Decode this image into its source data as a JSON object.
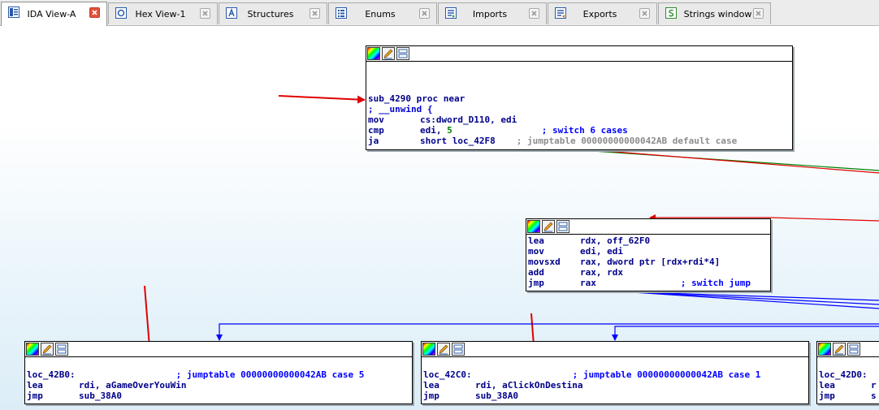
{
  "tabs": [
    {
      "label": "IDA View-A",
      "icon": "ida-view-icon",
      "active": true
    },
    {
      "label": "Hex View-1",
      "icon": "hex-view-icon",
      "active": false
    },
    {
      "label": "Structures",
      "icon": "structures-icon",
      "active": false
    },
    {
      "label": "Enums",
      "icon": "enums-icon",
      "active": false
    },
    {
      "label": "Imports",
      "icon": "imports-icon",
      "active": false
    },
    {
      "label": "Exports",
      "icon": "exports-icon",
      "active": false
    },
    {
      "label": "Strings window",
      "icon": "strings-icon",
      "active": false
    }
  ],
  "node_main": {
    "proc_line": "sub_4290 proc near",
    "unwind": "; __unwind {",
    "l1_mn": "mov",
    "l1_op": "cs:dword_D110, edi",
    "l2_mn": "cmp",
    "l2_op": "edi, ",
    "l2_num": "5",
    "l2_cmt": "; switch 6 cases",
    "l3_mn": "ja",
    "l3_op": "short loc_42F8",
    "l3_cmt": "; jumptable 00000000000042AB default case"
  },
  "node_switch": {
    "l1_mn": "lea",
    "l1_op": "rdx, off_62F0",
    "l2_mn": "mov",
    "l2_op": "edi, edi",
    "l3_mn": "movsxd",
    "l3_op": "rax, dword ptr [rdx+rdi*4]",
    "l4_mn": "add",
    "l4_op": "rax, rdx",
    "l5_mn": "jmp",
    "l5_op": "rax",
    "l5_cmt": "; switch jump"
  },
  "node_b0": {
    "label": "loc_42B0:",
    "label_cmt": "; jumptable 00000000000042AB case 5",
    "l1_mn": "lea",
    "l1_op": "rdi, aGameOverYouWin",
    "l2_mn": "jmp",
    "l2_op": "sub_38A0"
  },
  "node_c0": {
    "label": "loc_42C0:",
    "label_cmt": "; jumptable 00000000000042AB case 1",
    "l1_mn": "lea",
    "l1_op": "rdi, aClickOnDestina",
    "l2_mn": "jmp",
    "l2_op": "sub_38A0"
  },
  "node_d0": {
    "label": "loc_42D0:",
    "l1_mn": "lea",
    "l1_op": "r",
    "l2_mn": "jmp",
    "l2_op": "s"
  },
  "colors": {
    "arrow_red": "#e00000",
    "edge_blue": "#0000ff",
    "edge_green": "#008000",
    "code_text": "#00008b",
    "comment_gray": "#8c8c8c",
    "active_tab_close": "#e2503a"
  }
}
